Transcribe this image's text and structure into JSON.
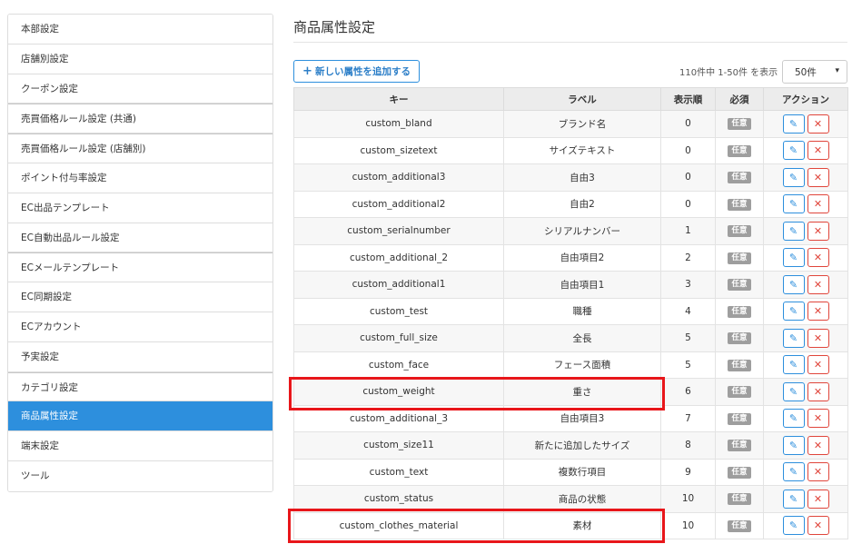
{
  "sidebar": {
    "items": [
      {
        "label": "本部設定"
      },
      {
        "label": "店舗別設定"
      },
      {
        "label": "クーポン設定"
      },
      {
        "label": "売買価格ルール設定 (共通)"
      },
      {
        "label": "売買価格ルール設定 (店舗別)"
      },
      {
        "label": "ポイント付与率設定"
      },
      {
        "label": "EC出品テンプレート"
      },
      {
        "label": "EC自動出品ルール設定"
      },
      {
        "label": "ECメールテンプレート"
      },
      {
        "label": "EC同期設定"
      },
      {
        "label": "ECアカウント"
      },
      {
        "label": "予実設定"
      },
      {
        "label": "カテゴリ設定"
      },
      {
        "label": "商品属性設定"
      },
      {
        "label": "端末設定"
      },
      {
        "label": "ツール"
      }
    ]
  },
  "main": {
    "title": "商品属性設定",
    "add_button_label": "新しい属性を追加する",
    "count_text": "110件中 1-50件 を表示",
    "per_page_value": "50件"
  },
  "table": {
    "headers": {
      "key": "キー",
      "label": "ラベル",
      "order": "表示順",
      "required": "必須",
      "action": "アクション"
    },
    "rows": [
      {
        "key": "custom_bland",
        "label": "ブランド名",
        "order": "0",
        "required": "任意"
      },
      {
        "key": "custom_sizetext",
        "label": "サイズテキスト",
        "order": "0",
        "required": "任意"
      },
      {
        "key": "custom_additional3",
        "label": "自由3",
        "order": "0",
        "required": "任意"
      },
      {
        "key": "custom_additional2",
        "label": "自由2",
        "order": "0",
        "required": "任意"
      },
      {
        "key": "custom_serialnumber",
        "label": "シリアルナンバー",
        "order": "1",
        "required": "任意"
      },
      {
        "key": "custom_additional_2",
        "label": "自由項目2",
        "order": "2",
        "required": "任意"
      },
      {
        "key": "custom_additional1",
        "label": "自由項目1",
        "order": "3",
        "required": "任意"
      },
      {
        "key": "custom_test",
        "label": "職種",
        "order": "4",
        "required": "任意"
      },
      {
        "key": "custom_full_size",
        "label": "全長",
        "order": "5",
        "required": "任意"
      },
      {
        "key": "custom_face",
        "label": "フェース面積",
        "order": "5",
        "required": "任意"
      },
      {
        "key": "custom_weight",
        "label": "重さ",
        "order": "6",
        "required": "任意"
      },
      {
        "key": "custom_additional_3",
        "label": "自由項目3",
        "order": "7",
        "required": "任意"
      },
      {
        "key": "custom_size11",
        "label": "新たに追加したサイズ",
        "order": "8",
        "required": "任意"
      },
      {
        "key": "custom_text",
        "label": "複数行項目",
        "order": "9",
        "required": "任意"
      },
      {
        "key": "custom_status",
        "label": "商品の状態",
        "order": "10",
        "required": "任意"
      },
      {
        "key": "custom_clothes_material",
        "label": "素材",
        "order": "10",
        "required": "任意"
      }
    ]
  },
  "colors": {
    "accent": "#2d8fdd",
    "danger": "#e0453b",
    "highlight": "#e8161a",
    "badge": "#9e9e9e"
  },
  "icons": {
    "add": "plus-icon",
    "edit": "pencil-icon",
    "delete": "close-icon",
    "select": "chevron-down-icon"
  }
}
